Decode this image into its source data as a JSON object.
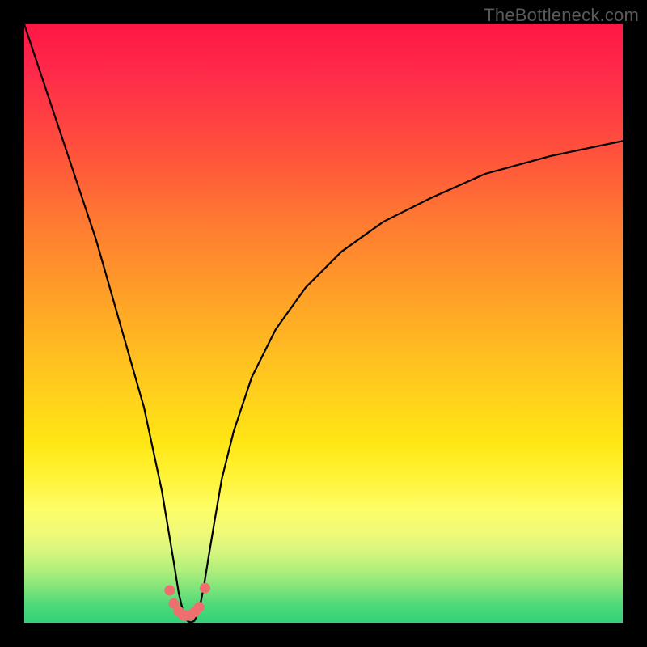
{
  "watermark": "TheBottleneck.com",
  "chart_data": {
    "type": "line",
    "title": "",
    "xlabel": "",
    "ylabel": "",
    "xlim": [
      0,
      100
    ],
    "ylim": [
      0,
      100
    ],
    "grid": false,
    "legend": false,
    "series": [
      {
        "name": "bottleneck-curve",
        "x": [
          0,
          3,
          6,
          9,
          12,
          14,
          16,
          18,
          20,
          21.5,
          23,
          24,
          25,
          25.8,
          26.5,
          27,
          27.3,
          27.6,
          28,
          28.4,
          28.8,
          29.4,
          30,
          30.8,
          31.8,
          33,
          35,
          38,
          42,
          47,
          53,
          60,
          68,
          77,
          88,
          100
        ],
        "y": [
          100,
          91,
          82,
          73,
          64,
          57,
          50,
          43,
          36,
          29,
          22,
          16,
          10,
          5,
          2,
          0.8,
          0.3,
          0.1,
          0.1,
          0.3,
          1.1,
          3,
          6,
          11,
          17,
          24,
          32,
          41,
          49,
          56,
          62,
          67,
          71,
          75,
          78,
          80.5
        ]
      }
    ],
    "markers": {
      "name": "bottom-dots",
      "x": [
        24.3,
        25,
        25.8,
        26.5,
        27.1,
        27.8,
        28.5,
        29.2,
        30.2
      ],
      "y": [
        5.4,
        3.2,
        1.9,
        1.3,
        1.2,
        1.3,
        1.8,
        2.6,
        5.8
      ],
      "color": "#ef6e6e",
      "radius": 6.5
    }
  },
  "colors": {
    "curve": "#000000",
    "markers": "#ef6e6e",
    "gradient_top": "#ff1744",
    "gradient_mid": "#ffc020",
    "gradient_bottom": "#2fd278",
    "frame": "#000000"
  }
}
